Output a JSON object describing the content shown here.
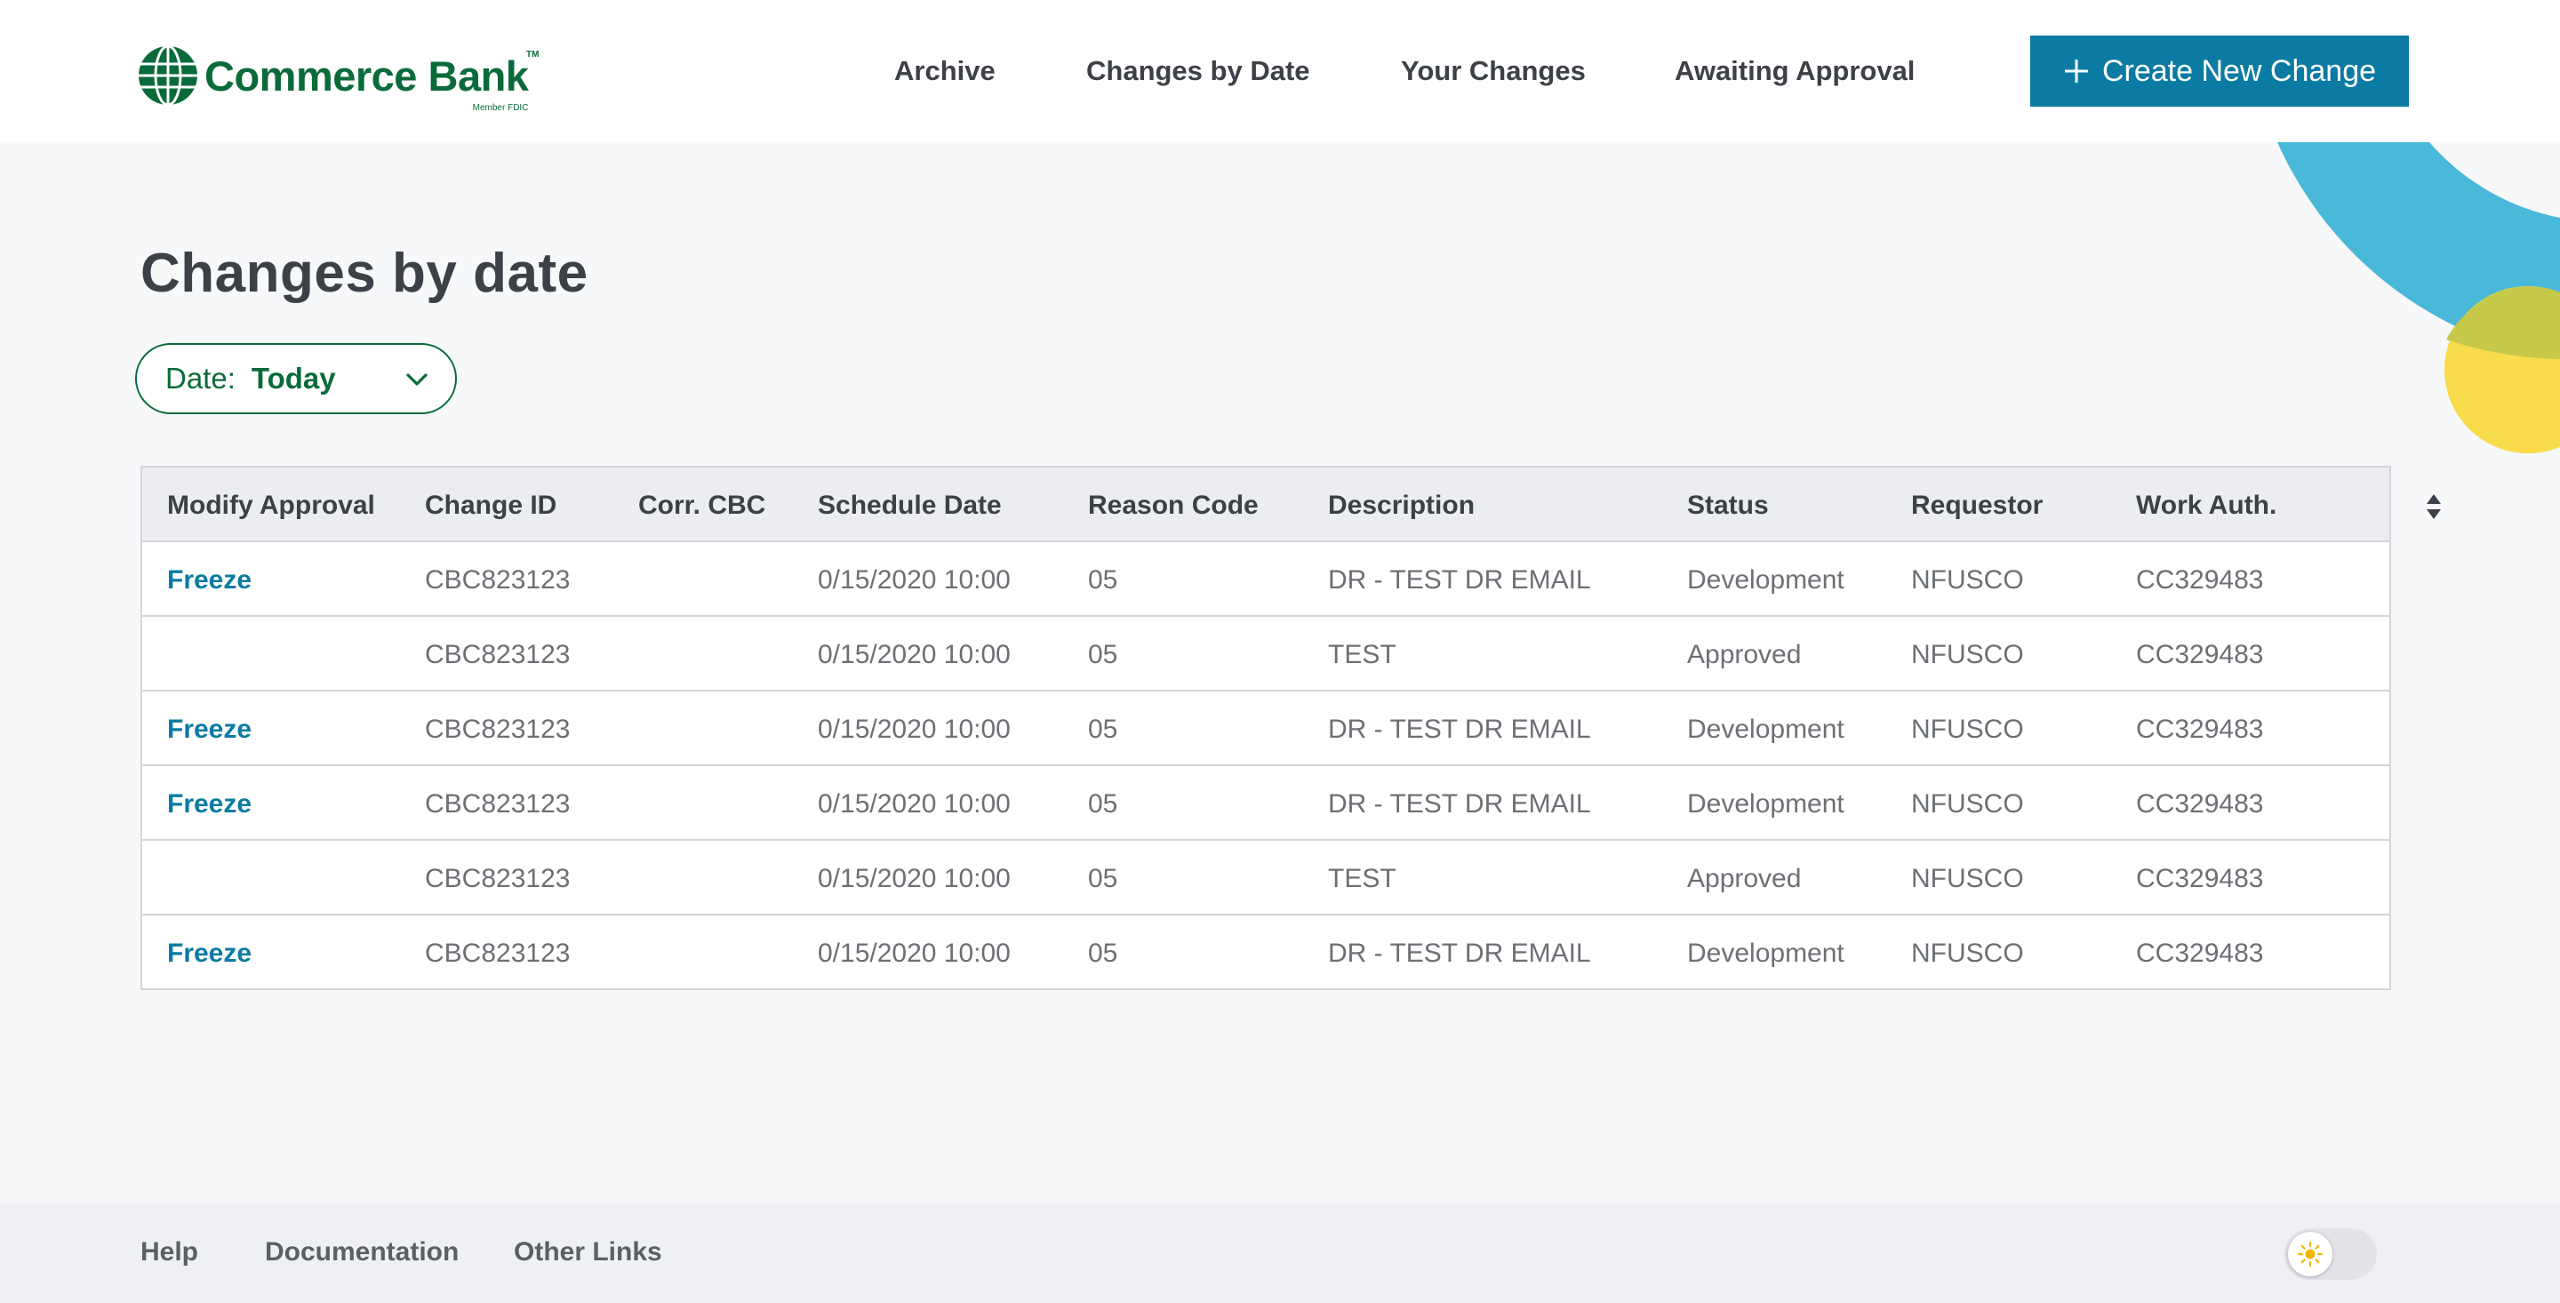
{
  "brand": {
    "name": "Commerce Bank",
    "trademark": "TM",
    "member": "Member FDIC"
  },
  "nav": {
    "archive": "Archive",
    "changes_by_date": "Changes by Date",
    "your_changes": "Your Changes",
    "awaiting_approval": "Awaiting Approval"
  },
  "create_button": {
    "label": "Create New Change",
    "icon": "plus-icon"
  },
  "page": {
    "title": "Changes by date",
    "date_filter": {
      "label": "Date:",
      "value": "Today",
      "icon": "chevron-down-icon"
    }
  },
  "table": {
    "columns": [
      "Modify Approval",
      "Change ID",
      "Corr. CBC",
      "Schedule Date",
      "Reason Code",
      "Description",
      "Status",
      "Requestor",
      "Work Auth."
    ],
    "rows": [
      {
        "modify": "Freeze",
        "change_id": "CBC823123",
        "corr": "",
        "date": "0/15/2020 10:00",
        "reason": "05",
        "description": "DR - TEST DR EMAIL",
        "status": "Development",
        "requestor": "NFUSCO",
        "work_auth": "CC329483"
      },
      {
        "modify": "",
        "change_id": "CBC823123",
        "corr": "",
        "date": "0/15/2020 10:00",
        "reason": "05",
        "description": "TEST",
        "status": "Approved",
        "requestor": "NFUSCO",
        "work_auth": "CC329483"
      },
      {
        "modify": "Freeze",
        "change_id": "CBC823123",
        "corr": "",
        "date": "0/15/2020 10:00",
        "reason": "05",
        "description": "DR - TEST DR EMAIL",
        "status": "Development",
        "requestor": "NFUSCO",
        "work_auth": "CC329483"
      },
      {
        "modify": "Freeze",
        "change_id": "CBC823123",
        "corr": "",
        "date": "0/15/2020 10:00",
        "reason": "05",
        "description": "DR - TEST DR EMAIL",
        "status": "Development",
        "requestor": "NFUSCO",
        "work_auth": "CC329483"
      },
      {
        "modify": "",
        "change_id": "CBC823123",
        "corr": "",
        "date": "0/15/2020 10:00",
        "reason": "05",
        "description": "TEST",
        "status": "Approved",
        "requestor": "NFUSCO",
        "work_auth": "CC329483"
      },
      {
        "modify": "Freeze",
        "change_id": "CBC823123",
        "corr": "",
        "date": "0/15/2020 10:00",
        "reason": "05",
        "description": "DR - TEST DR EMAIL",
        "status": "Development",
        "requestor": "NFUSCO",
        "work_auth": "CC329483"
      }
    ]
  },
  "footer": {
    "help": "Help",
    "documentation": "Documentation",
    "other_links": "Other Links",
    "theme_toggle_icon": "sun-icon"
  },
  "colors": {
    "brand_green": "#0a6b3a",
    "accent_blue": "#0b7ba3",
    "deco_cyan": "#4ab8d8",
    "deco_yellow": "#f8dc4c"
  }
}
